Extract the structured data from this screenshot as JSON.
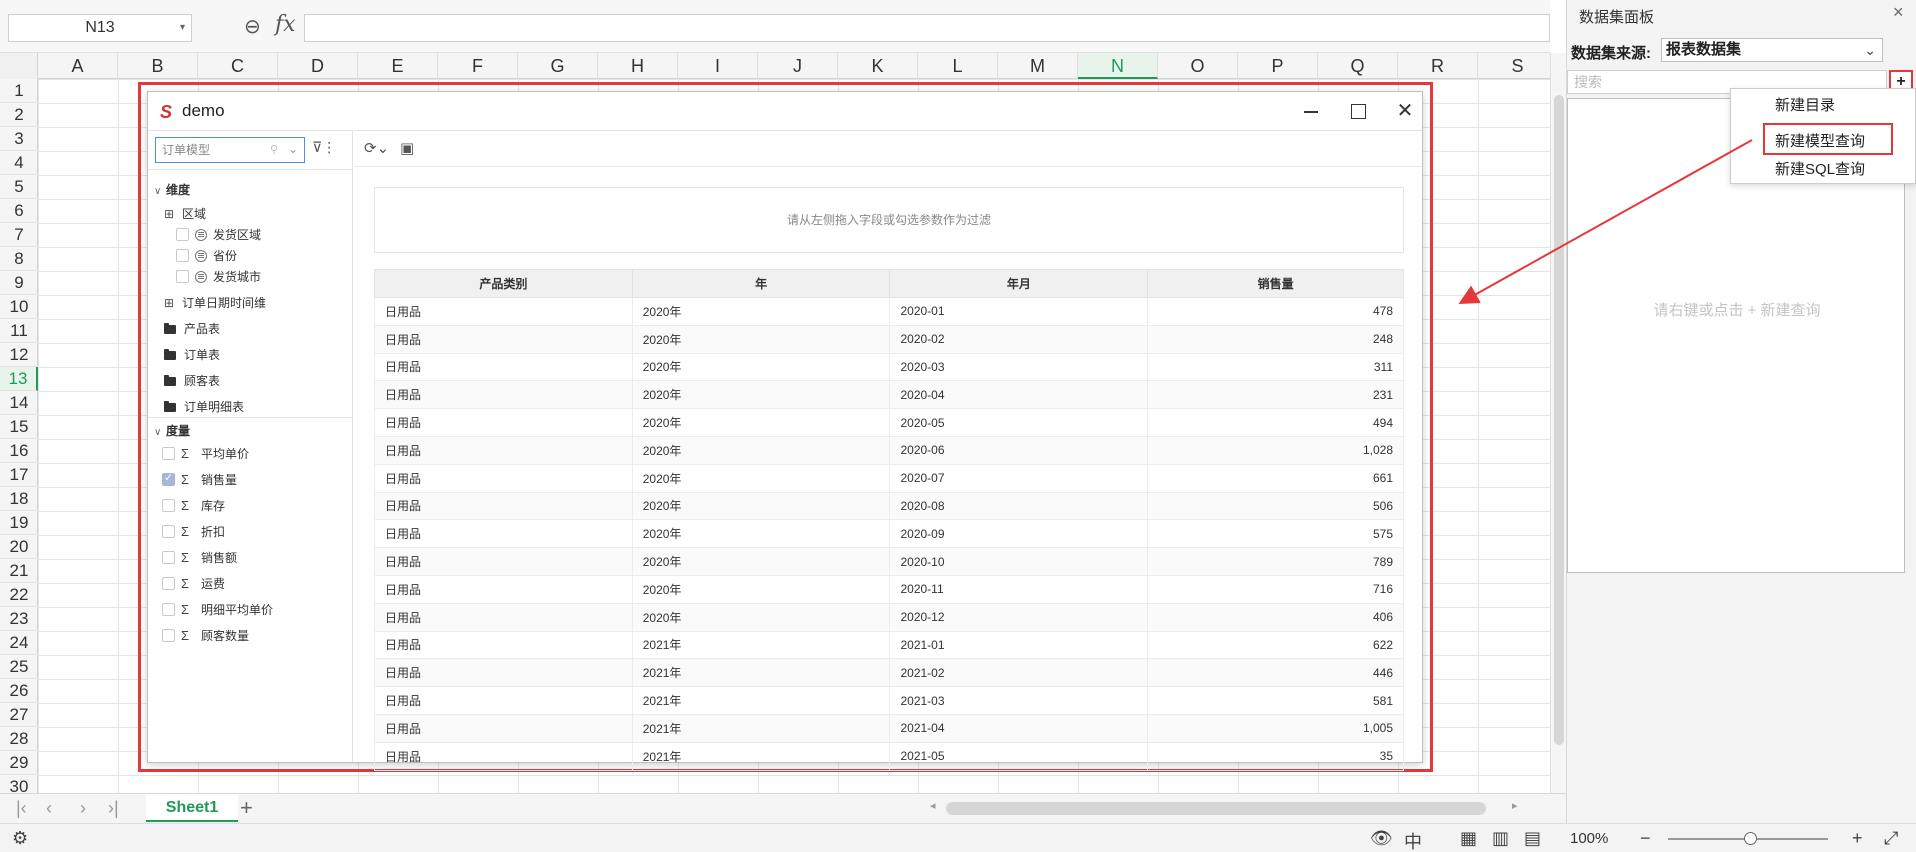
{
  "formula_bar": {
    "name_box": "N13",
    "fx": "fx",
    "formula": ""
  },
  "grid": {
    "columns": [
      "A",
      "B",
      "C",
      "D",
      "E",
      "F",
      "G",
      "H",
      "I",
      "J",
      "K",
      "L",
      "M",
      "N",
      "O",
      "P",
      "Q",
      "R",
      "S"
    ],
    "active_column": "N",
    "rows": [
      "1",
      "2",
      "3",
      "4",
      "5",
      "6",
      "7",
      "8",
      "9",
      "10",
      "11",
      "12",
      "13",
      "14",
      "15",
      "16",
      "17",
      "18",
      "19",
      "20",
      "21",
      "22",
      "23",
      "24",
      "25",
      "26",
      "27",
      "28",
      "29",
      "30"
    ],
    "active_row": "13"
  },
  "sheet_tabs": {
    "active": "Sheet1",
    "add": "+"
  },
  "status": {
    "zoom": "100%"
  },
  "dialog": {
    "title": "demo",
    "model_select": "订单模型",
    "dimension_header": "维度",
    "measure_header": "度量",
    "tree": {
      "region": "区域",
      "region_children": [
        "发货区域",
        "省份",
        "发货城市"
      ],
      "order_date": "订单日期时间维",
      "folders": [
        "产品表",
        "订单表",
        "顾客表",
        "订单明细表"
      ],
      "measures": [
        "平均单价",
        "销售量",
        "库存",
        "折扣",
        "销售额",
        "运费",
        "明细平均单价",
        "顾客数量"
      ],
      "checked_measure": "销售量"
    },
    "filter_hint": "请从左侧拖入字段或勾选参数作为过滤",
    "table": {
      "headers": [
        "产品类别",
        "年",
        "年月",
        "销售量"
      ],
      "rows": [
        [
          "日用品",
          "2020年",
          "2020-01",
          "478"
        ],
        [
          "日用品",
          "2020年",
          "2020-02",
          "248"
        ],
        [
          "日用品",
          "2020年",
          "2020-03",
          "311"
        ],
        [
          "日用品",
          "2020年",
          "2020-04",
          "231"
        ],
        [
          "日用品",
          "2020年",
          "2020-05",
          "494"
        ],
        [
          "日用品",
          "2020年",
          "2020-06",
          "1,028"
        ],
        [
          "日用品",
          "2020年",
          "2020-07",
          "661"
        ],
        [
          "日用品",
          "2020年",
          "2020-08",
          "506"
        ],
        [
          "日用品",
          "2020年",
          "2020-09",
          "575"
        ],
        [
          "日用品",
          "2020年",
          "2020-10",
          "789"
        ],
        [
          "日用品",
          "2020年",
          "2020-11",
          "716"
        ],
        [
          "日用品",
          "2020年",
          "2020-12",
          "406"
        ],
        [
          "日用品",
          "2021年",
          "2021-01",
          "622"
        ],
        [
          "日用品",
          "2021年",
          "2021-02",
          "446"
        ],
        [
          "日用品",
          "2021年",
          "2021-03",
          "581"
        ],
        [
          "日用品",
          "2021年",
          "2021-04",
          "1,005"
        ],
        [
          "日用品",
          "2021年",
          "2021-05",
          "35"
        ]
      ]
    }
  },
  "dataset_panel": {
    "title": "数据集面板",
    "source_label": "数据集来源:",
    "source_value": "报表数据集",
    "search_placeholder": "搜索",
    "add": "+",
    "empty_hint": "请右键或点击 + 新建查询",
    "context_menu": [
      "新建目录",
      "新建模型查询",
      "新建SQL查询"
    ]
  }
}
